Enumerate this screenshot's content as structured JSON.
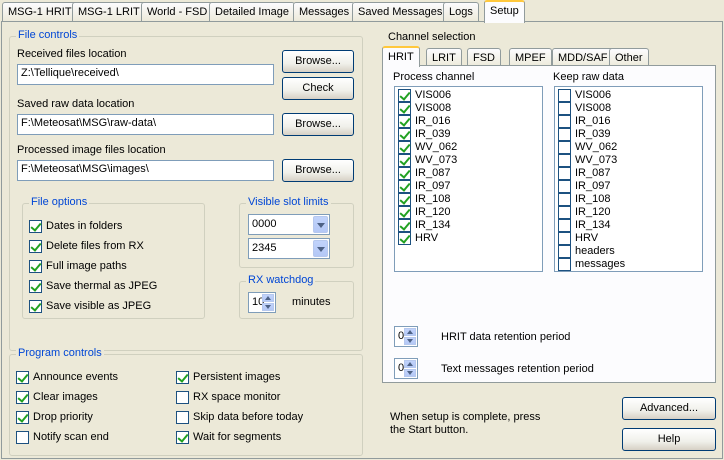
{
  "tabs": [
    "MSG-1 HRIT",
    "MSG-1 LRIT",
    "World - FSD",
    "Detailed Image",
    "Messages",
    "Saved Messages",
    "Logs",
    "Setup"
  ],
  "file_controls": {
    "title": "File controls",
    "received_label": "Received files location",
    "received_value": "Z:\\Tellique\\received\\",
    "saved_label": "Saved raw data location",
    "saved_value": "F:\\Meteosat\\MSG\\raw-data\\",
    "processed_label": "Processed image files location",
    "processed_value": "F:\\Meteosat\\MSG\\images\\",
    "browse": "Browse...",
    "check": "Check"
  },
  "file_options": {
    "title": "File options",
    "items": [
      {
        "label": "Dates in folders",
        "checked": true
      },
      {
        "label": "Delete files from RX",
        "checked": true
      },
      {
        "label": "Full image paths",
        "checked": true
      },
      {
        "label": "Save thermal as JPEG",
        "checked": true
      },
      {
        "label": "Save visible as JPEG",
        "checked": true
      }
    ]
  },
  "slot_limits": {
    "title": "Visible slot limits",
    "from": "0000",
    "to": "2345"
  },
  "watchdog": {
    "title": "RX watchdog",
    "value": "10",
    "unit": "minutes"
  },
  "program_controls": {
    "title": "Program controls",
    "left": [
      {
        "label": "Announce events",
        "checked": true
      },
      {
        "label": "Clear images",
        "checked": true
      },
      {
        "label": "Drop priority",
        "checked": true
      },
      {
        "label": "Notify scan end",
        "checked": false
      }
    ],
    "right": [
      {
        "label": "Persistent images",
        "checked": true
      },
      {
        "label": "RX space monitor",
        "checked": false
      },
      {
        "label": "Skip data before today",
        "checked": false
      },
      {
        "label": "Wait for segments",
        "checked": true
      }
    ]
  },
  "channel_selection": {
    "title": "Channel selection",
    "subtabs": [
      "HRIT",
      "LRIT",
      "FSD",
      "MPEF",
      "MDD/SAF",
      "Other"
    ],
    "process_label": "Process channel",
    "keep_label": "Keep raw data",
    "process": [
      {
        "label": "VIS006",
        "checked": true
      },
      {
        "label": "VIS008",
        "checked": true
      },
      {
        "label": "IR_016",
        "checked": true
      },
      {
        "label": "IR_039",
        "checked": true
      },
      {
        "label": "WV_062",
        "checked": true
      },
      {
        "label": "WV_073",
        "checked": true
      },
      {
        "label": "IR_087",
        "checked": true
      },
      {
        "label": "IR_097",
        "checked": true
      },
      {
        "label": "IR_108",
        "checked": true
      },
      {
        "label": "IR_120",
        "checked": true
      },
      {
        "label": "IR_134",
        "checked": true
      },
      {
        "label": "HRV",
        "checked": true
      }
    ],
    "keep": [
      {
        "label": "VIS006",
        "checked": false
      },
      {
        "label": "VIS008",
        "checked": false
      },
      {
        "label": "IR_016",
        "checked": false
      },
      {
        "label": "IR_039",
        "checked": false
      },
      {
        "label": "WV_062",
        "checked": false
      },
      {
        "label": "WV_073",
        "checked": false
      },
      {
        "label": "IR_087",
        "checked": false
      },
      {
        "label": "IR_097",
        "checked": false
      },
      {
        "label": "IR_108",
        "checked": false
      },
      {
        "label": "IR_120",
        "checked": false
      },
      {
        "label": "IR_134",
        "checked": false
      },
      {
        "label": "HRV",
        "checked": false
      },
      {
        "label": "headers",
        "checked": false
      },
      {
        "label": "messages",
        "checked": false
      }
    ],
    "hrit_retention_value": "0",
    "hrit_retention_label": "HRIT data retention period",
    "text_retention_value": "0",
    "text_retention_label": "Text messages retention period"
  },
  "footer": {
    "note_line1": "When setup is complete, press",
    "note_line2": "the Start button.",
    "advanced": "Advanced...",
    "help": "Help"
  }
}
